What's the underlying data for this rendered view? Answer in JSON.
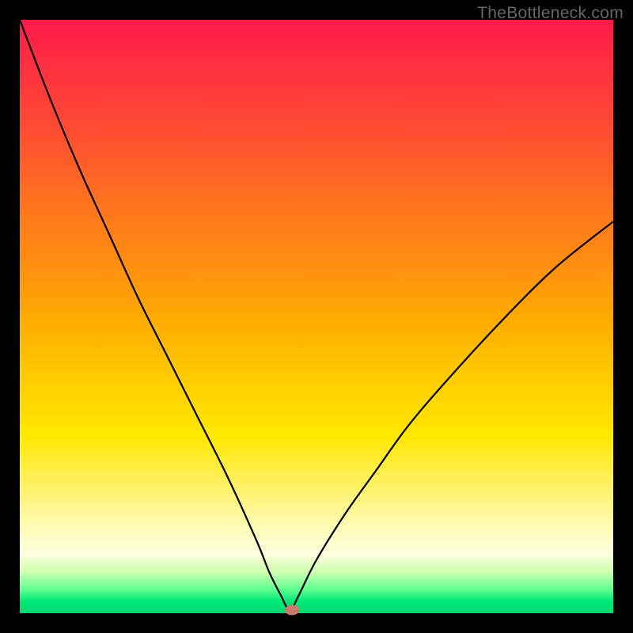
{
  "watermark": "TheBottleneck.com",
  "chart_data": {
    "type": "line",
    "title": "",
    "xlabel": "",
    "ylabel": "",
    "x": [
      0,
      5,
      10,
      15,
      20,
      25,
      30,
      35,
      40,
      42,
      44,
      45.5,
      47,
      50,
      55,
      60,
      65,
      70,
      80,
      90,
      100
    ],
    "y": [
      100,
      87,
      75,
      64,
      53,
      43,
      33,
      23,
      12,
      7,
      3,
      0.5,
      3,
      9,
      17,
      24,
      31,
      37,
      48,
      58,
      66
    ],
    "xlim": [
      0,
      100
    ],
    "ylim": [
      0,
      100
    ],
    "marker": {
      "x": 45.8,
      "y": 0.5
    },
    "gradient_bg": true,
    "note": "V-shaped bottleneck curve on red-to-green vertical gradient background"
  },
  "colors": {
    "curve": "#000000",
    "marker": "#c97a6a",
    "frame": "#000000"
  }
}
